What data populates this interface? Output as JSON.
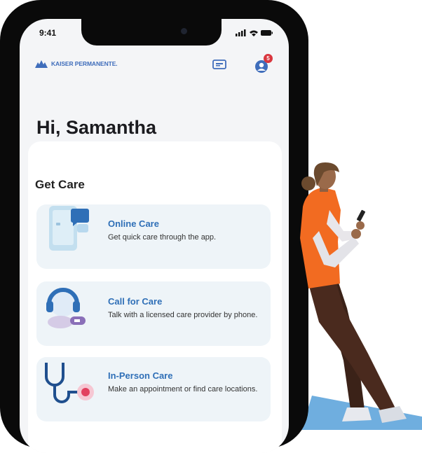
{
  "status_bar": {
    "time": "9:41"
  },
  "header": {
    "brand": "KAISER PERMANENTE.",
    "notification_count": "5"
  },
  "greeting": "Hi, Samantha",
  "get_care": {
    "title": "Get Care",
    "options": [
      {
        "title": "Online Care",
        "description": "Get quick care through the app.",
        "icon": "phone-chat-icon"
      },
      {
        "title": "Call for Care",
        "description": "Talk with a licensed care provider by phone.",
        "icon": "headset-icon"
      },
      {
        "title": "In-Person Care",
        "description": "Make an appointment or find care locations.",
        "icon": "stethoscope-icon"
      }
    ]
  },
  "colors": {
    "brand_blue": "#3f6dbb",
    "link_blue": "#2f6fb7",
    "badge_red": "#d9363e",
    "shirt_orange": "#f26b21"
  }
}
